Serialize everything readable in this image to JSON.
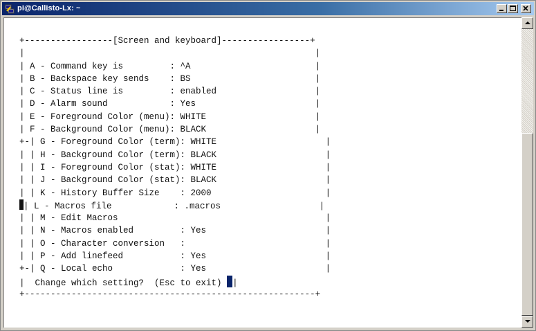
{
  "window": {
    "title": "pi@Callisto-Lx: ~",
    "icon": "putty-terminal-icon"
  },
  "terminal": {
    "lines": [
      "+-----------------[Screen and keyboard]-----------------+",
      "|                                                        |",
      "| A - Command key is         : ^A                        |",
      "| B - Backspace key sends    : BS                        |",
      "| C - Status line is         : enabled                   |",
      "| D - Alarm sound            : Yes                       |",
      "| E - Foreground Color (menu): WHITE                     |",
      "| F - Background Color (menu): BLACK                     |",
      "+-| G - Foreground Color (term): WHITE                     |",
      "| | H - Background Color (term): BLACK                     |",
      "| | I - Foreground Color (stat): WHITE                     |",
      "| | J - Background Color (stat): BLACK                     |",
      "| | K - History Buffer Size    : 2000                      |",
      "| L - Macros file            : .macros                   |",
      "| | M - Edit Macros                                        |",
      "| | N - Macros enabled         : Yes                       |",
      "| | O - Character conversion   :                           |",
      "| | P - Add linefeed           : Yes                       |",
      "+-| Q - Local echo             : Yes                       |",
      "|  Change which setting?  (Esc to exit) ",
      "+--------------------------------------------------------+"
    ],
    "prompt_tail": "|"
  }
}
